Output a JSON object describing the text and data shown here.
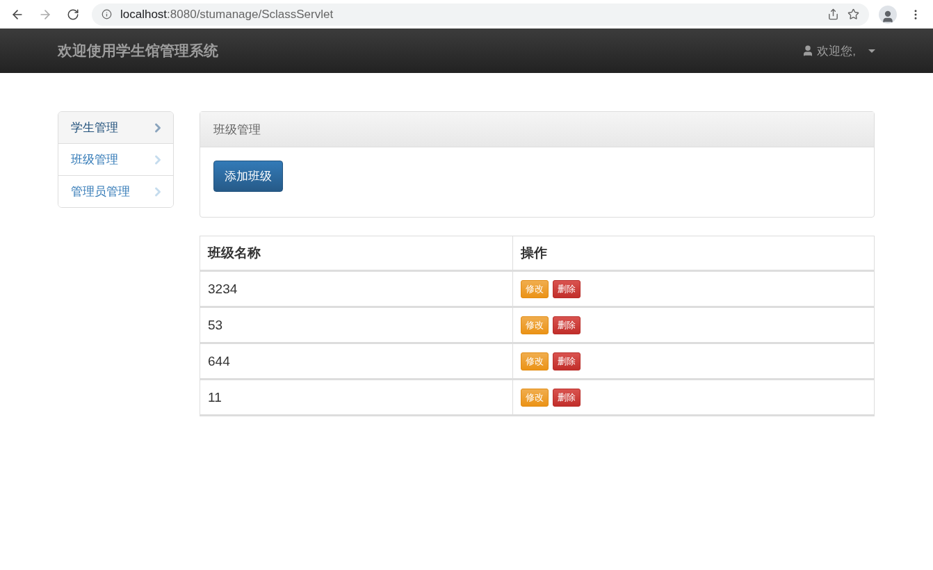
{
  "browser": {
    "url_host": "localhost",
    "url_rest": ":8080/stumanage/SclassServlet"
  },
  "navbar": {
    "brand": "欢迎使用学生馆管理系统",
    "user": "欢迎您,"
  },
  "sidebar": {
    "items": [
      {
        "label": "学生管理",
        "selected": true
      },
      {
        "label": "班级管理",
        "selected": false
      },
      {
        "label": "管理员管理",
        "selected": false
      }
    ]
  },
  "panel": {
    "title": "班级管理",
    "add_button": "添加班级"
  },
  "table": {
    "columns": [
      "班级名称",
      "操作"
    ],
    "rows": [
      {
        "name": "3234",
        "edit": "修改",
        "delete": "删除"
      },
      {
        "name": "53",
        "edit": "修改",
        "delete": "删除"
      },
      {
        "name": "644",
        "edit": "修改",
        "delete": "删除"
      },
      {
        "name": "11",
        "edit": "修改",
        "delete": "删除"
      }
    ]
  }
}
